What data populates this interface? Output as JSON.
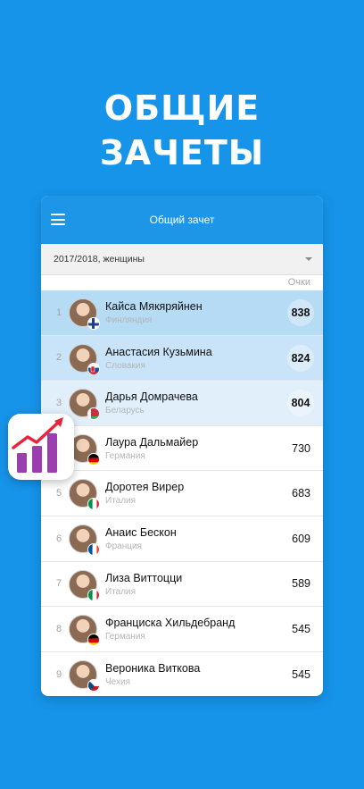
{
  "headline": {
    "line1": "ОБЩИЕ",
    "line2": "ЗАЧЕТЫ"
  },
  "app": {
    "title": "Общий зачет",
    "filter_value": "2017/2018, женщины",
    "points_header": "Очки"
  },
  "standings": [
    {
      "rank": "1",
      "name": "Кайса Мякяряйнен",
      "country": "Финляндия",
      "points": "838",
      "flag": "fi"
    },
    {
      "rank": "2",
      "name": "Анастасия Кузьмина",
      "country": "Словакия",
      "points": "824",
      "flag": "sk"
    },
    {
      "rank": "3",
      "name": "Дарья Домрачева",
      "country": "Беларусь",
      "points": "804",
      "flag": "by"
    },
    {
      "rank": "4",
      "name": "Лаура Дальмайер",
      "country": "Германия",
      "points": "730",
      "flag": "de"
    },
    {
      "rank": "5",
      "name": "Доротея Вирер",
      "country": "Италия",
      "points": "683",
      "flag": "it"
    },
    {
      "rank": "6",
      "name": "Анаис Бескон",
      "country": "Франция",
      "points": "609",
      "flag": "fr"
    },
    {
      "rank": "7",
      "name": "Лиза Виттоцци",
      "country": "Италия",
      "points": "589",
      "flag": "it"
    },
    {
      "rank": "8",
      "name": "Франциска Хильдебранд",
      "country": "Германия",
      "points": "545",
      "flag": "de"
    },
    {
      "rank": "9",
      "name": "Вероника Виткова",
      "country": "Чехия",
      "points": "545",
      "flag": "cz"
    }
  ],
  "colors": {
    "background": "#1694ea",
    "appbar": "#1e96e8",
    "highlight_1": "#b5dbf5",
    "highlight_2": "#c9e4f8",
    "highlight_3": "#e1effb",
    "chart_bars": "#9b3fb0",
    "chart_arrow": "#e8243c"
  },
  "icons": [
    "menu-icon",
    "dropdown-caret-icon",
    "growth-chart-icon"
  ]
}
